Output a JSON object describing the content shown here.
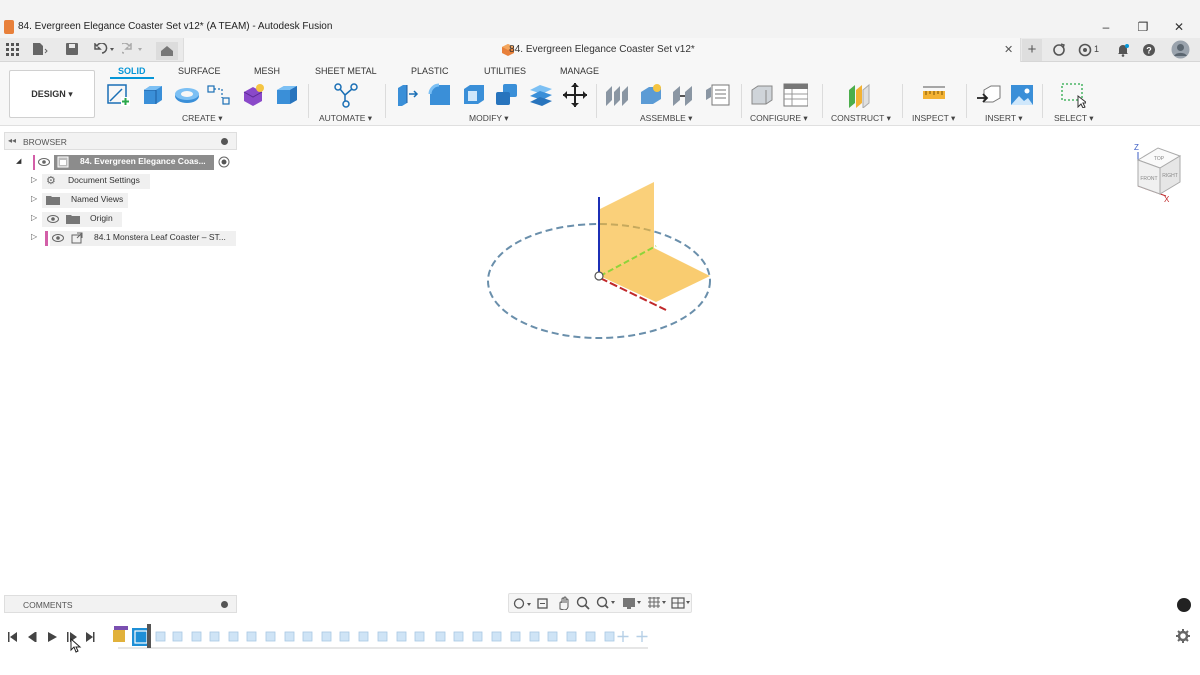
{
  "window": {
    "title": "84. Evergreen Elegance Coaster Set v12* (A TEAM) - Autodesk Fusion",
    "min": "–",
    "max": "❐",
    "close": "✕"
  },
  "tabbar": {
    "doc_title": "84. Evergreen Elegance Coaster Set v12*",
    "notif_count": "1"
  },
  "ribbon": {
    "workspace": "DESIGN ▾",
    "tabs": [
      "SOLID",
      "SURFACE",
      "MESH",
      "SHEET METAL",
      "PLASTIC",
      "UTILITIES",
      "MANAGE"
    ],
    "groups": [
      "CREATE ▾",
      "AUTOMATE ▾",
      "MODIFY ▾",
      "ASSEMBLE ▾",
      "CONFIGURE ▾",
      "CONSTRUCT ▾",
      "INSPECT ▾",
      "INSERT ▾",
      "SELECT ▾"
    ]
  },
  "browser": {
    "title": "BROWSER",
    "root": "84. Evergreen Elegance Coas...",
    "items": [
      "Document Settings",
      "Named Views",
      "Origin",
      "84.1 Monstera Leaf Coaster – ST..."
    ]
  },
  "comments": {
    "title": "COMMENTS"
  },
  "colors": {
    "accent": "#0696d7",
    "plane": "#f7b733",
    "axis_z": "#1c2fb5",
    "axis_x": "#c0282a",
    "axis_y": "#8ed43a"
  },
  "icons": [
    "grid-icon",
    "file-icon",
    "save-icon",
    "undo-icon",
    "redo-icon",
    "home-icon",
    "close-icon",
    "add-tab-icon",
    "sync-icon",
    "job-status-icon",
    "bell-icon",
    "help-icon",
    "user-avatar"
  ],
  "viewcube": {
    "top": "TOP",
    "front": "FRONT",
    "right": "RIGHT",
    "z": "Z",
    "x": "X"
  }
}
